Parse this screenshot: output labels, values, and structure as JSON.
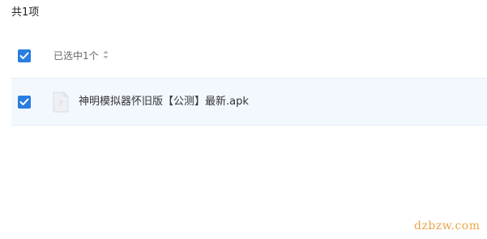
{
  "summary": {
    "count_text": "共1项"
  },
  "header": {
    "select_all_checked": true,
    "selected_label": "已选中1个",
    "sort_icon": "sort-updown-icon"
  },
  "files": [
    {
      "checked": true,
      "icon": "unknown-file-icon",
      "name": "神明模拟器怀旧版【公测】最新.apk"
    }
  ],
  "watermark": {
    "text": "dzbzw.com"
  },
  "colors": {
    "checkbox_blue": "#2a7de1",
    "row_highlight": "#f2f8fe",
    "watermark_orange": "#e8a64a"
  }
}
